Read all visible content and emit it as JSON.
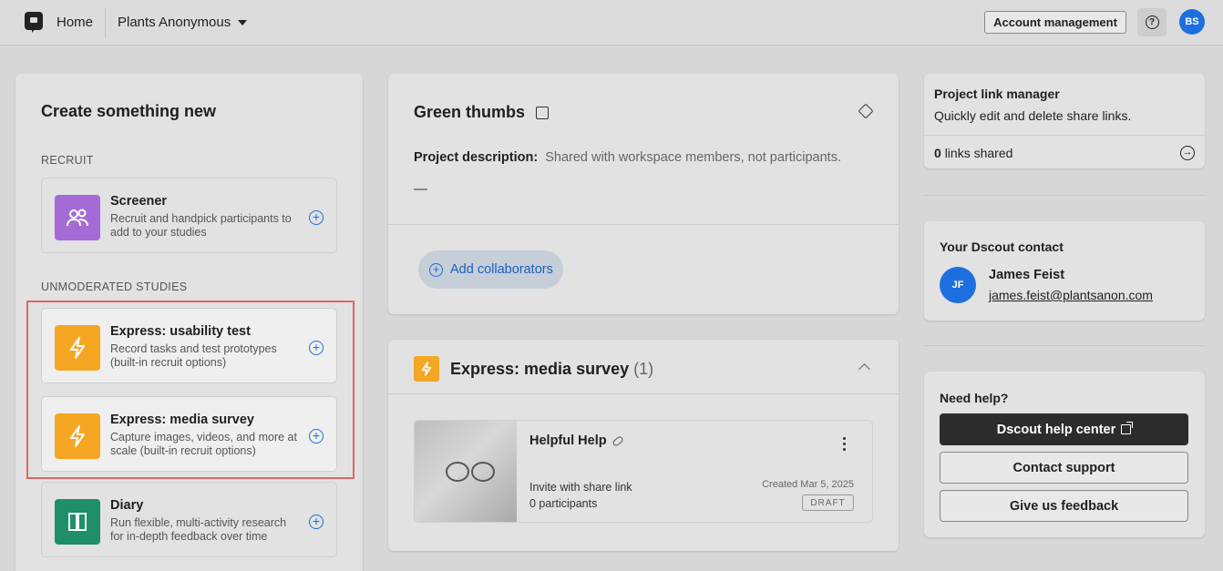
{
  "topbar": {
    "home": "Home",
    "workspace": "Plants Anonymous",
    "account_button": "Account management",
    "help_icon": "?",
    "avatar": "BS"
  },
  "create": {
    "title": "Create something new",
    "recruit_label": "RECRUIT",
    "unmoderated_label": "UNMODERATED STUDIES",
    "options": [
      {
        "title": "Screener",
        "desc": "Recruit and handpick participants to add to your studies",
        "icon": "people-icon",
        "color": "#a46bd6"
      },
      {
        "title": "Express: usability test",
        "desc": "Record tasks and test prototypes (built-in recruit options)",
        "icon": "bolt-icon",
        "color": "#f5a623"
      },
      {
        "title": "Express: media survey",
        "desc": "Capture images, videos, and more at scale (built-in recruit options)",
        "icon": "bolt-icon",
        "color": "#f5a623"
      },
      {
        "title": "Diary",
        "desc": "Run flexible, multi-activity research for in-depth feedback over time",
        "icon": "diary-icon",
        "color": "#1f8f6a"
      }
    ]
  },
  "project": {
    "title": "Green thumbs",
    "desc_label": "Project description:",
    "desc_hint": "Shared with workspace members, not participants.",
    "desc_value": "—",
    "collab_button": "Add collaborators"
  },
  "section": {
    "title": "Express: media survey",
    "count": "(1)",
    "item": {
      "name": "Helpful Help",
      "invite": "Invite with share link",
      "participants": "0 participants",
      "created": "Created Mar 5, 2025",
      "status": "DRAFT"
    }
  },
  "link_manager": {
    "title": "Project link manager",
    "subtitle": "Quickly edit and delete share links.",
    "count": "0",
    "count_suffix": "links shared"
  },
  "contact": {
    "title": "Your Dscout contact",
    "initials": "JF",
    "name": "James Feist",
    "email": "james.feist@plantsanon.com"
  },
  "help": {
    "title": "Need help?",
    "center": "Dscout help center",
    "support": "Contact support",
    "feedback": "Give us feedback"
  },
  "colors": {
    "accent": "#1d6fe0",
    "bolt": "#f5a623",
    "highlight": "#e06666"
  }
}
